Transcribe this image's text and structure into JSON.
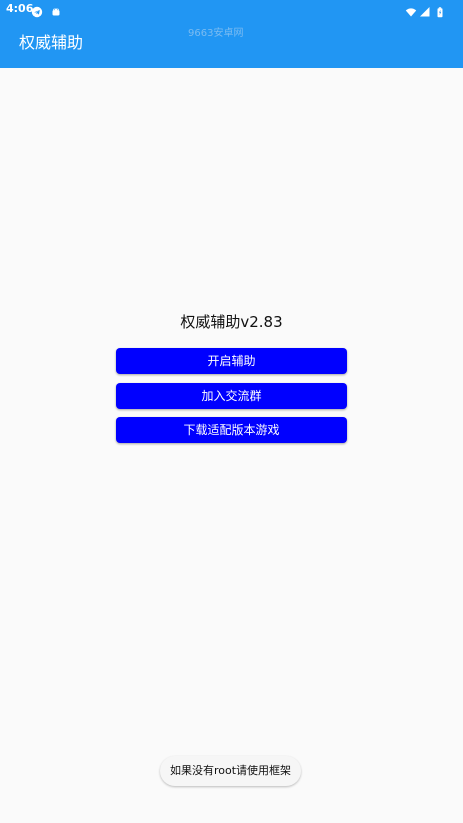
{
  "status_bar": {
    "time": "4:06",
    "icons_left": [
      "telegram-icon",
      "android-icon"
    ],
    "icons_right": [
      "wifi-icon",
      "signal-icon",
      "battery-icon"
    ]
  },
  "app_bar": {
    "title": "权威辅助",
    "watermark": "9663安卓网",
    "background": "#2196f3"
  },
  "main": {
    "title": "权威辅助v2.83",
    "buttons": [
      {
        "label": "开启辅助"
      },
      {
        "label": "加入交流群"
      },
      {
        "label": "下载适配版本游戏"
      }
    ],
    "button_color": "#0000ff"
  },
  "toast": {
    "text": "如果没有root请使用框架"
  }
}
